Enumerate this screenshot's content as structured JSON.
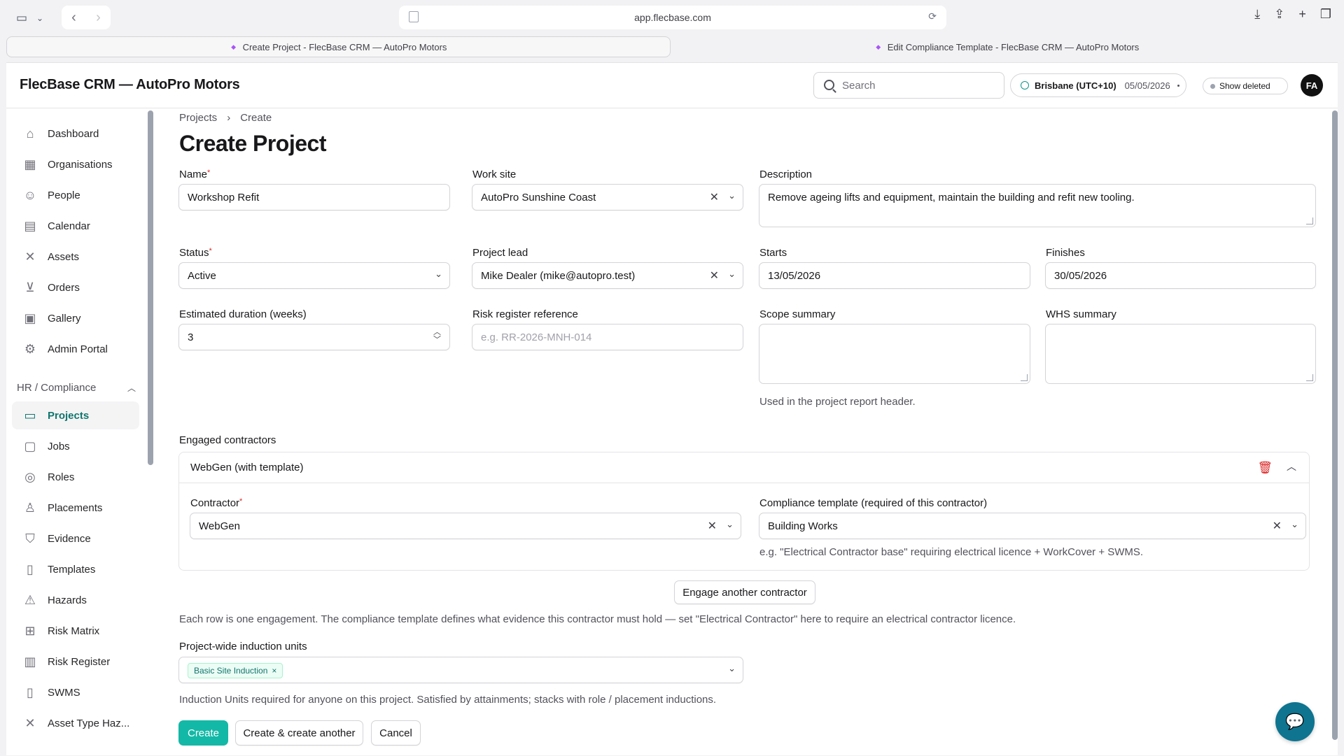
{
  "browser": {
    "url": "app.flecbase.com",
    "tabs": [
      {
        "label": "Create Project - FlecBase CRM — AutoPro Motors",
        "active": true
      },
      {
        "label": "Edit Compliance Template - FlecBase CRM — AutoPro Motors",
        "active": false
      }
    ]
  },
  "header": {
    "brand": "FlecBase CRM — AutoPro Motors",
    "search_placeholder": "Search",
    "timezone": "Brisbane (UTC+10)",
    "date": "05/05/2026",
    "show_deleted": "Show deleted",
    "avatar_initials": "FA"
  },
  "sidebar": {
    "items": [
      {
        "label": "Dashboard",
        "icon": "home-icon"
      },
      {
        "label": "Organisations",
        "icon": "building-icon"
      },
      {
        "label": "People",
        "icon": "user-icon"
      },
      {
        "label": "Calendar",
        "icon": "calendar-icon"
      },
      {
        "label": "Assets",
        "icon": "tools-icon"
      },
      {
        "label": "Orders",
        "icon": "cart-icon"
      },
      {
        "label": "Gallery",
        "icon": "image-icon"
      },
      {
        "label": "Admin Portal",
        "icon": "gear-icon"
      }
    ],
    "section": "HR / Compliance",
    "section_items": [
      {
        "label": "Projects",
        "icon": "folder-icon",
        "active": true
      },
      {
        "label": "Jobs",
        "icon": "briefcase-icon"
      },
      {
        "label": "Roles",
        "icon": "pin-icon"
      },
      {
        "label": "Placements",
        "icon": "user-plus-icon"
      },
      {
        "label": "Evidence",
        "icon": "shield-check-icon"
      },
      {
        "label": "Templates",
        "icon": "document-icon"
      },
      {
        "label": "Hazards",
        "icon": "warning-icon"
      },
      {
        "label": "Risk Matrix",
        "icon": "grid-icon"
      },
      {
        "label": "Risk Register",
        "icon": "clipboard-icon"
      },
      {
        "label": "SWMS",
        "icon": "file-icon"
      },
      {
        "label": "Asset Type Haz...",
        "icon": "tools-icon"
      }
    ]
  },
  "breadcrumb": {
    "items": [
      "Projects",
      "Create"
    ]
  },
  "page_title": "Create Project",
  "form": {
    "name": {
      "label": "Name",
      "value": "Workshop Refit"
    },
    "work_site": {
      "label": "Work site",
      "value": "AutoPro Sunshine Coast"
    },
    "description": {
      "label": "Description",
      "value": "Remove ageing lifts and equipment, maintain the building and refit new tooling."
    },
    "status": {
      "label": "Status",
      "value": "Active"
    },
    "project_lead": {
      "label": "Project lead",
      "value": "Mike Dealer (mike@autopro.test)"
    },
    "starts": {
      "label": "Starts",
      "value": "13/05/2026"
    },
    "finishes": {
      "label": "Finishes",
      "value": "30/05/2026"
    },
    "duration": {
      "label": "Estimated duration (weeks)",
      "value": "3"
    },
    "risk_ref": {
      "label": "Risk register reference",
      "placeholder": "e.g. RR-2026-MNH-014"
    },
    "scope": {
      "label": "Scope summary",
      "help": "Used in the project report header."
    },
    "whs": {
      "label": "WHS summary"
    }
  },
  "contractors": {
    "section_label": "Engaged contractors",
    "card_title": "WebGen (with template)",
    "contractor_label": "Contractor",
    "contractor_value": "WebGen",
    "template_label": "Compliance template (required of this contractor)",
    "template_value": "Building Works",
    "template_help": "e.g. \"Electrical Contractor base\" requiring electrical licence + WorkCover + SWMS.",
    "engage_button": "Engage another contractor",
    "help": "Each row is one engagement. The compliance template defines what evidence this contractor must hold — set \"Electrical Contractor\" here to require an electrical contractor licence."
  },
  "induction": {
    "label": "Project-wide induction units",
    "chip": "Basic Site Induction",
    "help": "Induction Units required for anyone on this project. Satisfied by attainments; stacks with role / placement inductions."
  },
  "actions": {
    "create": "Create",
    "create_another": "Create & create another",
    "cancel": "Cancel"
  },
  "colors": {
    "accent": "#14b8a6",
    "accent_dark": "#0f766e",
    "danger": "#dc2626",
    "fab": "#0e7490"
  }
}
